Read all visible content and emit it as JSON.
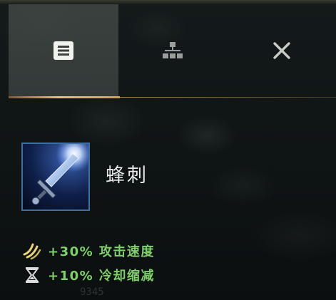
{
  "tabs": [
    {
      "icon": "list-icon",
      "active": true
    },
    {
      "icon": "hierarchy-icon",
      "active": false
    },
    {
      "icon": "close-icon",
      "active": false
    }
  ],
  "colors": {
    "active_tab_bg": "#4a524e",
    "gold_accent": "#e3c178",
    "stat_text": "#7fd06a",
    "item_border": "#3f6f9c"
  },
  "item": {
    "name": "蜂刺",
    "icon": "dagger-icon"
  },
  "stats": [
    {
      "icon": "attack-speed-icon",
      "text": "+30% 攻击速度"
    },
    {
      "icon": "hourglass-icon",
      "text": "+10% 冷却缩减"
    }
  ],
  "background_number": "9345"
}
